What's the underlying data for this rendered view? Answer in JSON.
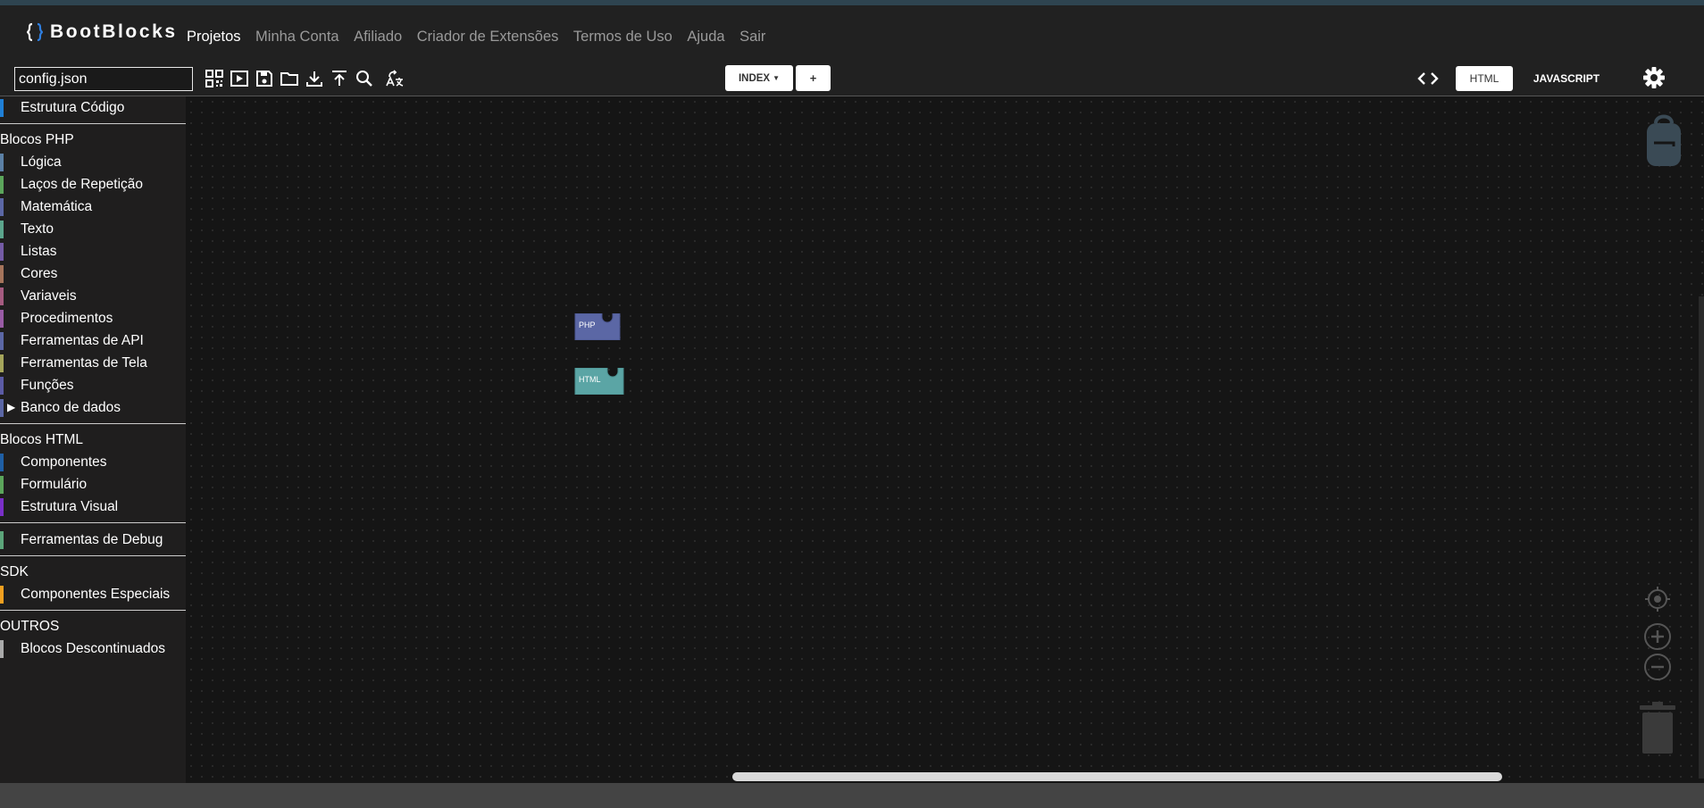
{
  "app": {
    "brand": "BootBlocks",
    "brand_icon": "braces-logo-icon",
    "colors": {
      "navbar": "#212121",
      "sidebar": "#1f1e1e",
      "workspace": "#151515",
      "php_block": "#5b67a5",
      "html_block": "#5ba5a5"
    }
  },
  "nav": {
    "links": [
      "Projetos",
      "Minha Conta",
      "Afiliado",
      "Criador de Extensões",
      "Termos de Uso",
      "Ajuda",
      "Sair"
    ],
    "active": "Projetos"
  },
  "toolbar": {
    "file_value": "config.json",
    "tools": [
      "qrcode-icon",
      "play-icon",
      "save-icon",
      "folder-icon",
      "download-icon",
      "upload-icon",
      "search-icon",
      "translate-icon"
    ],
    "page_select_label": "INDEX",
    "add_label": "+",
    "code_toggle_icon": "code-icon",
    "tab_html": "HTML",
    "tab_js": "JAVASCRIPT",
    "settings_icon": "gear-icon"
  },
  "sidebar": {
    "top": [
      {
        "label": "Estrutura Código",
        "color": "#1f7fd6"
      }
    ],
    "groups": [
      {
        "title": "Blocos PHP",
        "items": [
          {
            "label": "Lógica",
            "color": "#5b80a5"
          },
          {
            "label": "Laços de Repetição",
            "color": "#5ba55b"
          },
          {
            "label": "Matemática",
            "color": "#5b67a5"
          },
          {
            "label": "Texto",
            "color": "#5ba58c"
          },
          {
            "label": "Listas",
            "color": "#745ba5"
          },
          {
            "label": "Cores",
            "color": "#a5745b"
          },
          {
            "label": "Variaveis",
            "color": "#a55b80"
          },
          {
            "label": "Procedimentos",
            "color": "#995ba5"
          },
          {
            "label": "Ferramentas de API",
            "color": "#5b67a5"
          },
          {
            "label": "Ferramentas de Tela",
            "color": "#a5a55b"
          },
          {
            "label": "Funções",
            "color": "#5b5ba5"
          },
          {
            "label": "Banco de dados",
            "color": "#5b67a5",
            "expandable": true
          }
        ]
      },
      {
        "title": "Blocos HTML",
        "items": [
          {
            "label": "Componentes",
            "color": "#1f5fa5"
          },
          {
            "label": "Formulário",
            "color": "#5ba55b"
          },
          {
            "label": "Estrutura Visual",
            "color": "#7a2fc7"
          }
        ]
      }
    ],
    "debug": {
      "label": "Ferramentas de Debug",
      "color": "#5ba57a"
    },
    "sdk": {
      "title": "SDK",
      "items": [
        {
          "label": "Componentes Especiais",
          "color": "#f0a020"
        }
      ]
    },
    "outros": {
      "title": "OUTROS",
      "items": [
        {
          "label": "Blocos Descontinuados",
          "color": "#aaaaaa"
        }
      ]
    }
  },
  "workspace": {
    "blocks": [
      {
        "label": "PHP",
        "color": "#5b67a5"
      },
      {
        "label": "HTML",
        "color": "#5ba5a5"
      }
    ],
    "controls": [
      "backpack-icon",
      "recenter-icon",
      "zoom-in-icon",
      "zoom-out-icon",
      "trash-icon"
    ]
  }
}
